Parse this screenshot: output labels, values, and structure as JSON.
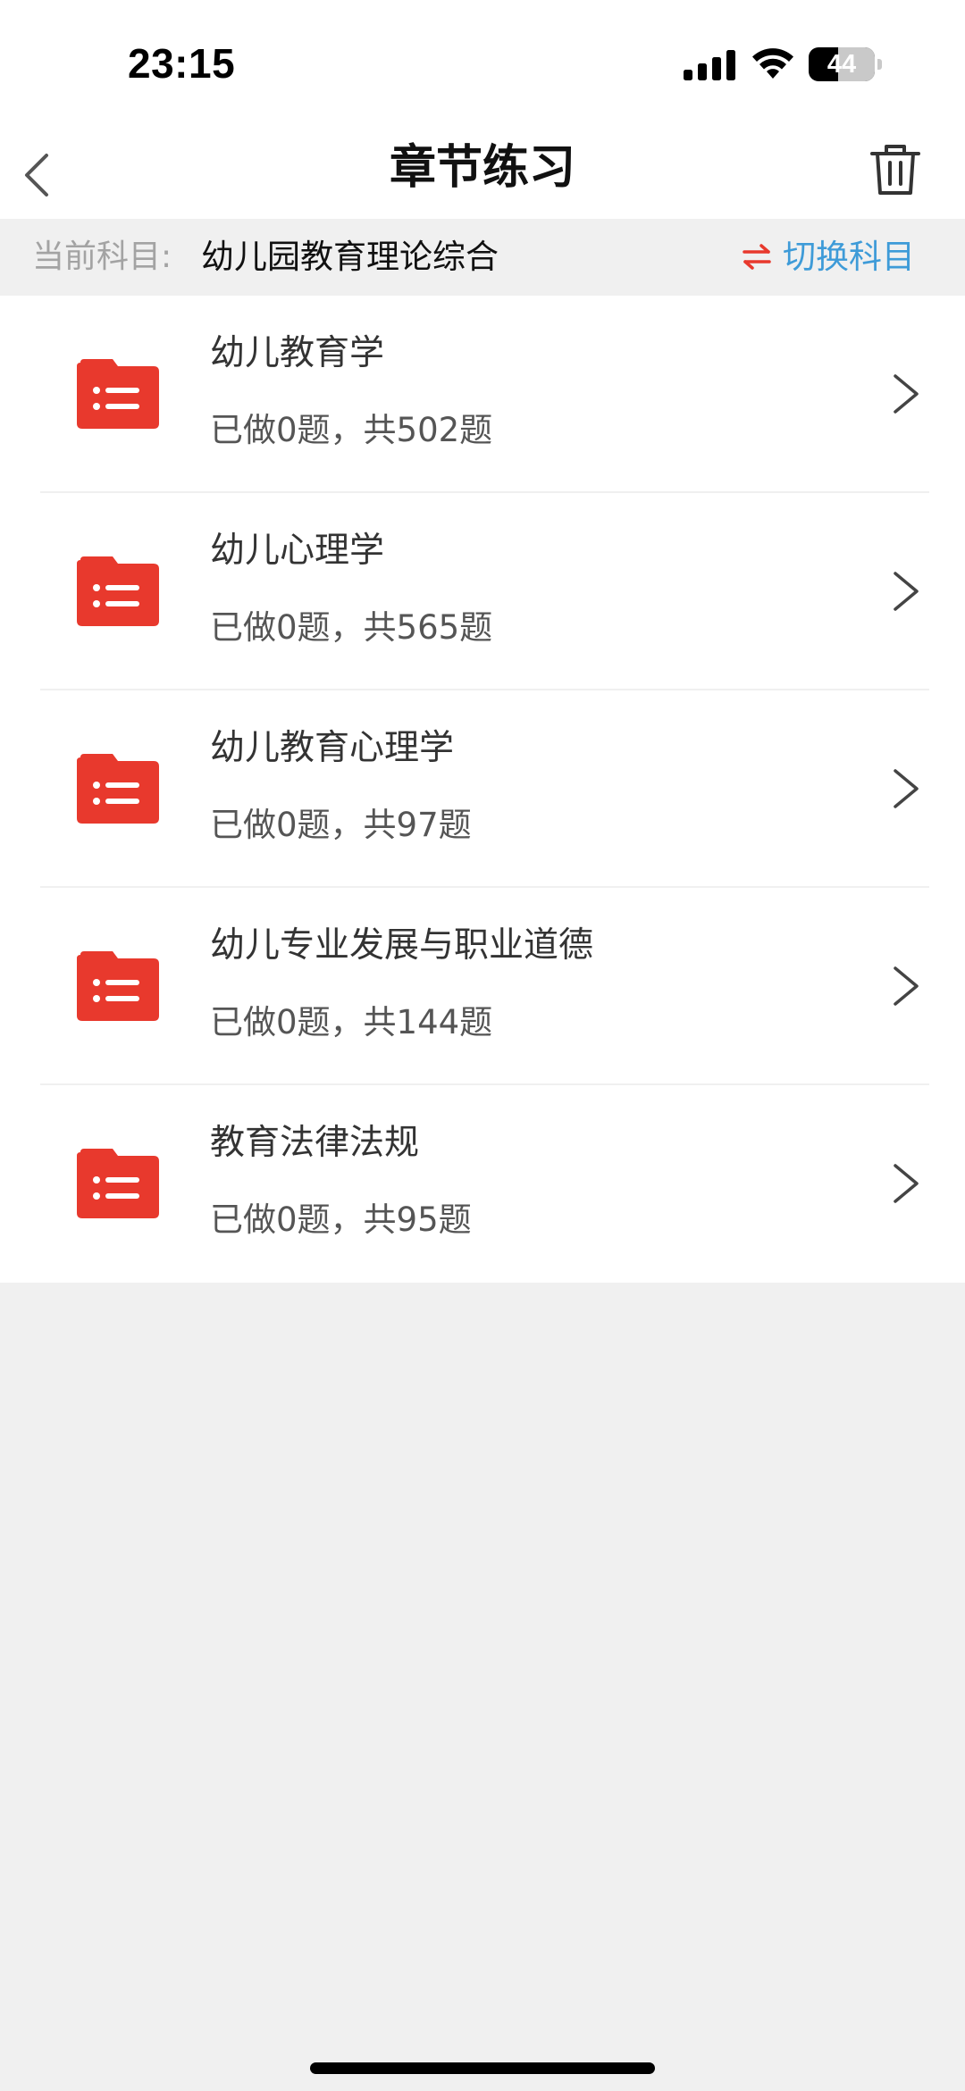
{
  "status_bar": {
    "time": "23:15",
    "battery": "44"
  },
  "header": {
    "title": "章节练习",
    "back_icon": "chevron-left-icon",
    "delete_icon": "trash-icon"
  },
  "subject_bar": {
    "label": "当前科目:",
    "value": "幼儿园教育理论综合",
    "switch_label": "切换科目",
    "switch_icon": "swap-arrows-icon"
  },
  "chapters": [
    {
      "title": "幼儿教育学",
      "progress": "已做0题，共502题",
      "icon": "folder-list-icon"
    },
    {
      "title": "幼儿心理学",
      "progress": "已做0题，共565题",
      "icon": "folder-list-icon"
    },
    {
      "title": "幼儿教育心理学",
      "progress": "已做0题，共97题",
      "icon": "folder-list-icon"
    },
    {
      "title": "幼儿专业发展与职业道德",
      "progress": "已做0题，共144题",
      "icon": "folder-list-icon"
    },
    {
      "title": "教育法律法规",
      "progress": "已做0题，共95题",
      "icon": "folder-list-icon"
    }
  ],
  "colors": {
    "accent_blue": "#3e9bd8",
    "folder_red": "#e8392d",
    "swap_icon_red": "#e8392d",
    "background": "#f0f0f0"
  }
}
